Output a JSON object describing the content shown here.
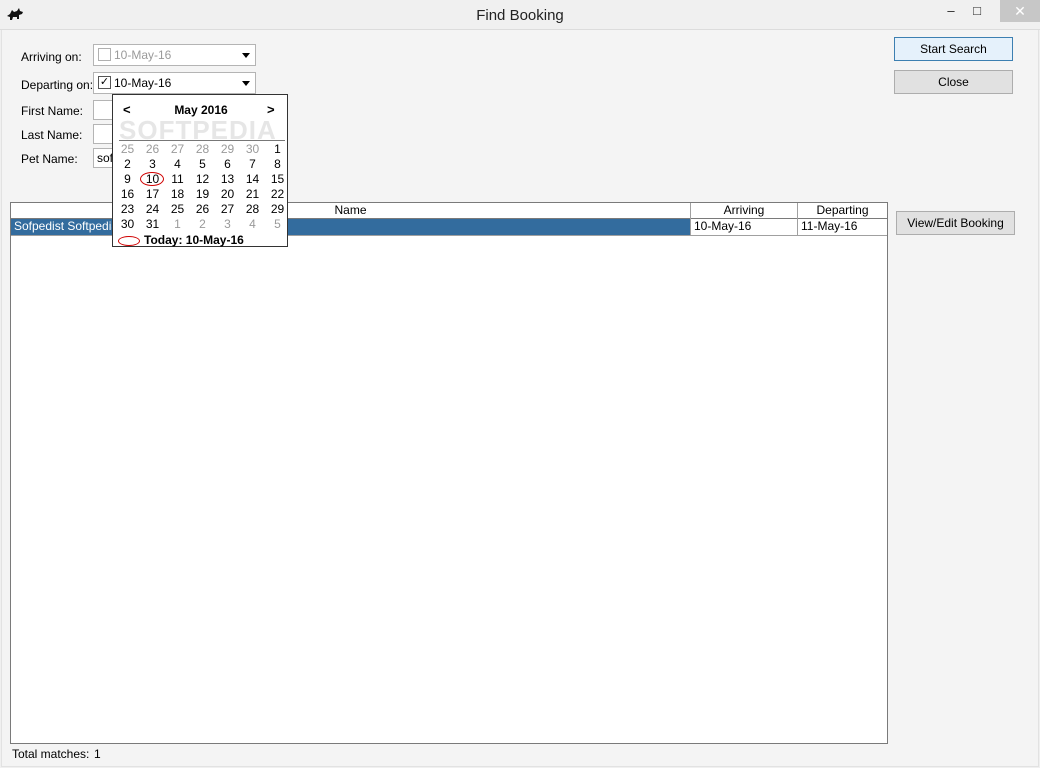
{
  "window": {
    "title": "Find Booking",
    "controls": {
      "minimize": "–",
      "maximize": "□",
      "close": "✕"
    },
    "app_icon": "dog-icon"
  },
  "form": {
    "arriving": {
      "label": "Arriving on:",
      "value": "10-May-16",
      "checked": false
    },
    "departing": {
      "label": "Departing on:",
      "value": "10-May-16",
      "checked": true
    },
    "first_name": {
      "label": "First Name:",
      "value": ""
    },
    "last_name": {
      "label": "Last Name:",
      "value": ""
    },
    "pet_name": {
      "label": "Pet Name:",
      "value": "soft"
    }
  },
  "buttons": {
    "start_search": "Start Search",
    "close": "Close",
    "view_edit": "View/Edit Booking"
  },
  "grid": {
    "columns": [
      "Name",
      "Arriving",
      "Departing"
    ],
    "rows": [
      {
        "name": "Sofpedist Softpedian",
        "arriving": "10-May-16",
        "departing": "11-May-16"
      }
    ]
  },
  "status": {
    "label": "Total matches:",
    "count": "1"
  },
  "calendar": {
    "month_label": "May 2016",
    "prev": "<",
    "next": ">",
    "watermark": "SOFTPEDIA",
    "weeks": [
      [
        "25",
        "26",
        "27",
        "28",
        "29",
        "30",
        "1"
      ],
      [
        "2",
        "3",
        "4",
        "5",
        "6",
        "7",
        "8"
      ],
      [
        "9",
        "10",
        "11",
        "12",
        "13",
        "14",
        "15"
      ],
      [
        "16",
        "17",
        "18",
        "19",
        "20",
        "21",
        "22"
      ],
      [
        "23",
        "24",
        "25",
        "26",
        "27",
        "28",
        "29"
      ],
      [
        "30",
        "31",
        "1",
        "2",
        "3",
        "4",
        "5"
      ]
    ],
    "today_label": "Today: 10-May-16",
    "accent_color": "#d00000"
  }
}
